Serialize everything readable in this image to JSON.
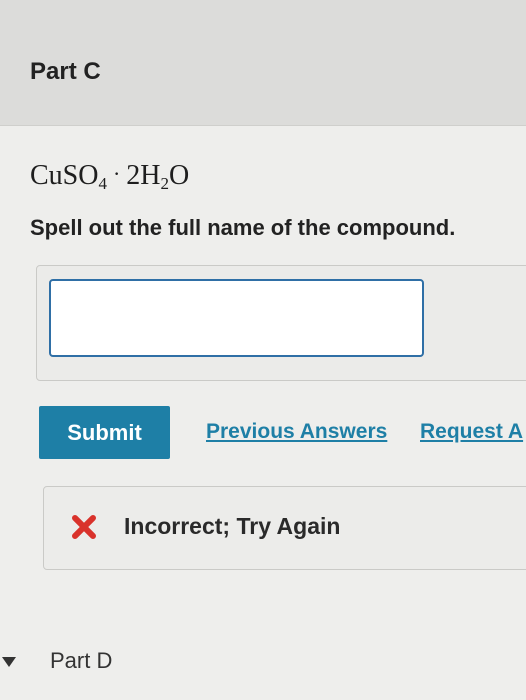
{
  "part_c": {
    "title": "Part C",
    "formula": {
      "cu": "CuSO",
      "sub4": "4",
      "dot": "·",
      "water_pre": "2H",
      "sub2": "2",
      "water_post": "O"
    },
    "instruction": "Spell out the full name of the compound.",
    "answer": {
      "value": "",
      "placeholder": ""
    },
    "submit_label": "Submit",
    "previous_answers_label": "Previous Answers",
    "request_answer_label": "Request A",
    "feedback": {
      "icon": "x-icon",
      "text": "Incorrect; Try Again",
      "color": "#d9322b"
    }
  },
  "part_d": {
    "title": "Part D",
    "icon": "caret-down-icon"
  },
  "colors": {
    "accent": "#1e7fa6",
    "input_border": "#2f6fa6",
    "error": "#d9322b"
  }
}
